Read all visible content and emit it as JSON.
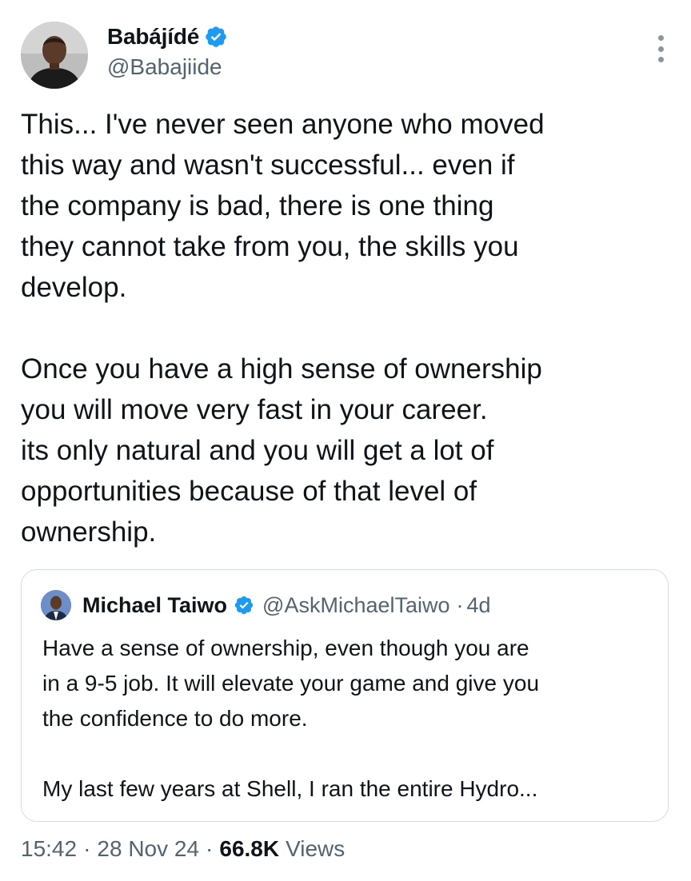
{
  "author": {
    "display_name": "Babájídé",
    "handle": "@Babajiide",
    "verified": true,
    "verified_color": "#1d9bf0"
  },
  "tweet": {
    "text": "This... I've never seen anyone who moved\nthis way and wasn't successful... even if\nthe company is bad, there is one thing\nthey cannot take from you, the skills you\ndevelop.\n\nOnce you have a high sense of ownership\nyou will move very fast in your career.\nits only natural and you will get a lot of\nopportunities because of that level of\nownership."
  },
  "quoted_tweet": {
    "display_name": "Michael Taiwo",
    "handle": "@AskMichaelTaiwo",
    "age": "4d",
    "separator": "·",
    "text": "Have a sense of ownership, even though you are\nin a 9-5 job. It will elevate your game and give you\nthe confidence to do more.\n\nMy last few years at Shell, I ran the entire Hydro..."
  },
  "footer": {
    "time": "15:42",
    "separator": "·",
    "date": "28 Nov 24",
    "views_count": "66.8K",
    "views_label": "Views"
  },
  "icons": {
    "more": "vertical-ellipsis-icon",
    "verified": "verified-badge-icon"
  },
  "colors": {
    "text_primary": "#0f1419",
    "text_secondary": "#536471",
    "border": "#d6dde2",
    "verified_blue": "#1d9bf0"
  }
}
